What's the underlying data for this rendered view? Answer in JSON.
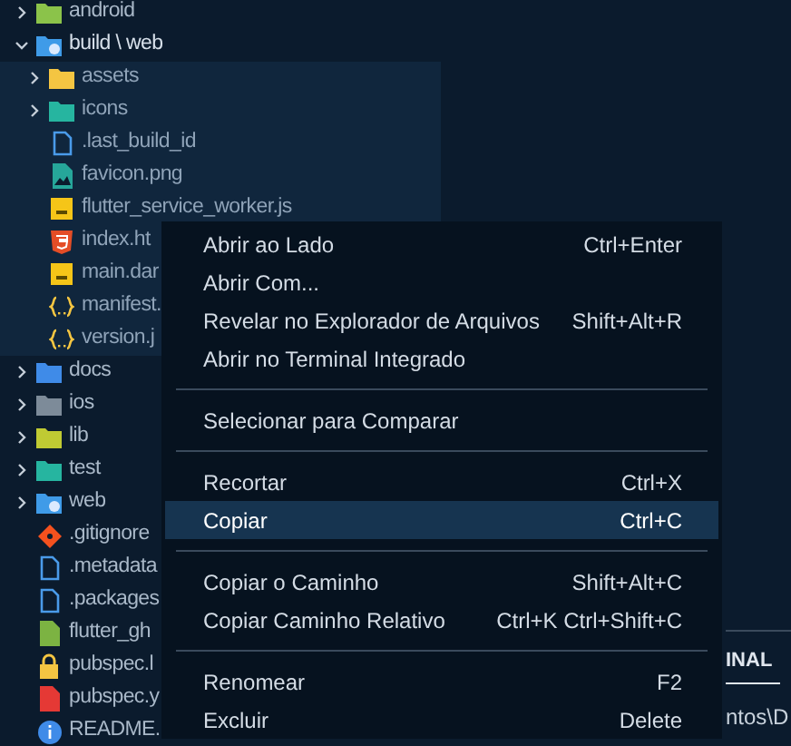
{
  "explorer": {
    "items": [
      {
        "name": "android",
        "kind": "folder",
        "color": "#8bc34a",
        "expanded": false,
        "selected": false
      },
      {
        "name": "build \\ web",
        "kind": "web-folder",
        "color": "#3f9be8",
        "expanded": true,
        "selected": true,
        "children": [
          {
            "name": "assets",
            "kind": "folder",
            "color": "#f4c542",
            "expanded": false,
            "selected": false
          },
          {
            "name": "icons",
            "kind": "folder",
            "color": "#26b5a0",
            "expanded": false,
            "selected": false
          },
          {
            "name": ".last_build_id",
            "kind": "file",
            "color": "#4a9bea",
            "selected": false
          },
          {
            "name": "favicon.png",
            "kind": "image",
            "selected": false
          },
          {
            "name": "flutter_service_worker.js",
            "kind": "js",
            "selected": false
          },
          {
            "name": "index.ht",
            "kind": "html",
            "selected": false
          },
          {
            "name": "main.dar",
            "kind": "js",
            "selected": false
          },
          {
            "name": "manifest.",
            "kind": "json",
            "selected": false
          },
          {
            "name": "version.j",
            "kind": "json",
            "selected": false
          }
        ]
      },
      {
        "name": "docs",
        "kind": "folder",
        "color": "#3f8be8",
        "expanded": false,
        "selected": false
      },
      {
        "name": "ios",
        "kind": "folder",
        "color": "#7d8b99",
        "expanded": false,
        "selected": false
      },
      {
        "name": "lib",
        "kind": "folder",
        "color": "#c0ca33",
        "expanded": false,
        "selected": false
      },
      {
        "name": "test",
        "kind": "folder",
        "color": "#26b5a0",
        "expanded": false,
        "selected": false
      },
      {
        "name": "web",
        "kind": "web-folder",
        "color": "#3f9be8",
        "expanded": false,
        "selected": false
      },
      {
        "name": ".gitignore",
        "kind": "git",
        "selected": false
      },
      {
        "name": ".metadata",
        "kind": "file",
        "color": "#4a9bea",
        "selected": false
      },
      {
        "name": ".packages",
        "kind": "file",
        "color": "#4a9bea",
        "selected": false
      },
      {
        "name": "flutter_gh",
        "kind": "solid-file",
        "color": "#7cb342",
        "selected": false
      },
      {
        "name": "pubspec.l",
        "kind": "lock",
        "selected": false
      },
      {
        "name": "pubspec.y",
        "kind": "solid-file",
        "color": "#e53935",
        "selected": false
      },
      {
        "name": "README.",
        "kind": "info",
        "selected": false
      }
    ]
  },
  "context_menu": {
    "groups": [
      [
        {
          "label": "Abrir ao Lado",
          "shortcut": "Ctrl+Enter",
          "selected": false
        },
        {
          "label": "Abrir Com...",
          "selected": false
        },
        {
          "label": "Revelar no Explorador de Arquivos",
          "shortcut": "Shift+Alt+R",
          "selected": false
        },
        {
          "label": "Abrir no Terminal Integrado",
          "selected": false
        }
      ],
      [
        {
          "label": "Selecionar para Comparar",
          "selected": false
        }
      ],
      [
        {
          "label": "Recortar",
          "shortcut": "Ctrl+X",
          "selected": false
        },
        {
          "label": "Copiar",
          "shortcut": "Ctrl+C",
          "selected": true
        }
      ],
      [
        {
          "label": "Copiar o Caminho",
          "shortcut": "Shift+Alt+C",
          "selected": false
        },
        {
          "label": "Copiar Caminho Relativo",
          "shortcut": "Ctrl+K Ctrl+Shift+C",
          "selected": false
        }
      ],
      [
        {
          "label": "Renomear",
          "shortcut": "F2",
          "selected": false
        },
        {
          "label": "Excluir",
          "shortcut": "Delete",
          "selected": false
        }
      ]
    ]
  },
  "panel": {
    "tab": "INAL",
    "terminal_text": "ntos\\D"
  }
}
